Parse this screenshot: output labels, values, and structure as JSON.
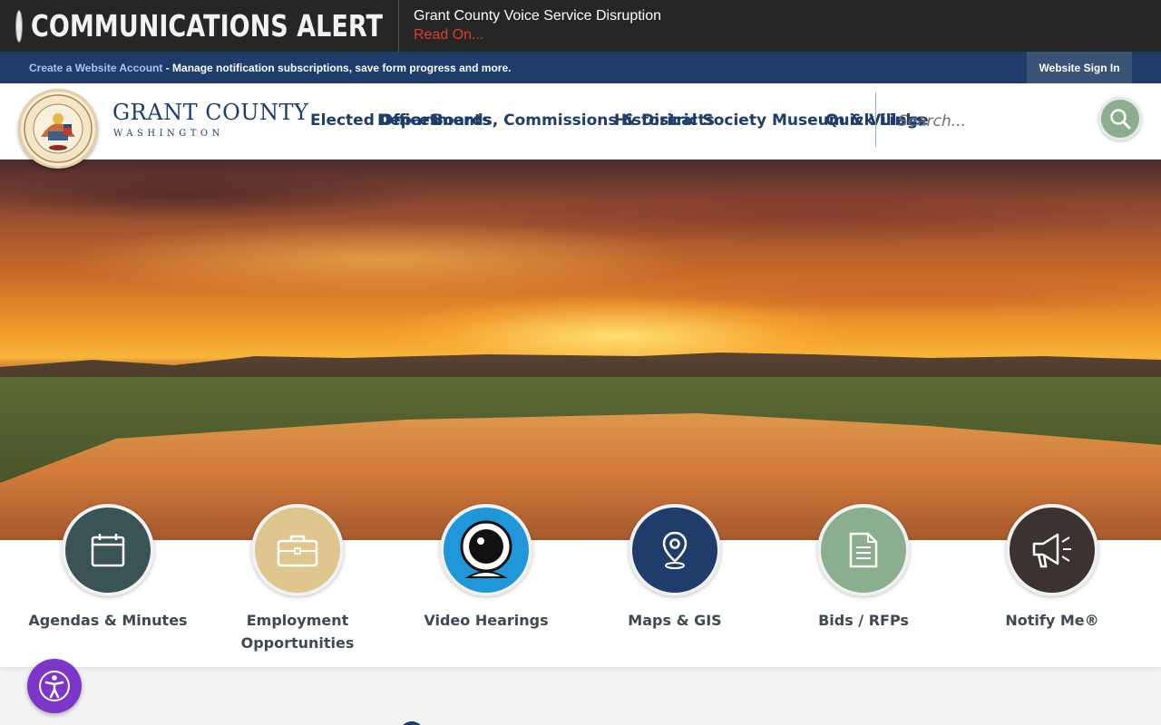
{
  "alert": {
    "title": "COMMUNICATIONS ALERT",
    "headline": "Grant County Voice Service Disruption",
    "read_on": "Read On..."
  },
  "account_bar": {
    "create_link": "Create a Website Account",
    "description": " - Manage notification subscriptions, save form progress and more.",
    "sign_in": "Website Sign In"
  },
  "header": {
    "logo_name": "GRANT COUNTY",
    "logo_sub": "WASHINGTON",
    "nav": [
      "Elected Offices",
      "Departments",
      "Boards, Commissions & Districts",
      "Historical Society Museum & Village",
      "Quick Links"
    ],
    "search_placeholder": "Search..."
  },
  "quick_links": [
    {
      "label": "Agendas & Minutes",
      "icon": "calendar-icon",
      "color": "#3a5355"
    },
    {
      "label": "Employment Opportunities",
      "icon": "briefcase-icon",
      "color": "#dfc68e"
    },
    {
      "label": "Video Hearings",
      "icon": "webcam-icon",
      "color": "#2196d8"
    },
    {
      "label": "Maps & GIS",
      "icon": "map-pin-icon",
      "color": "#1e3d6b"
    },
    {
      "label": "Bids / RFPs",
      "icon": "document-icon",
      "color": "#8aae8e"
    },
    {
      "label": "Notify Me®",
      "icon": "megaphone-icon",
      "color": "#3b3330"
    }
  ],
  "colors": {
    "navy": "#1e3d6b",
    "alert_red": "#e23b2a",
    "accessibility_purple": "#7c37c9"
  }
}
